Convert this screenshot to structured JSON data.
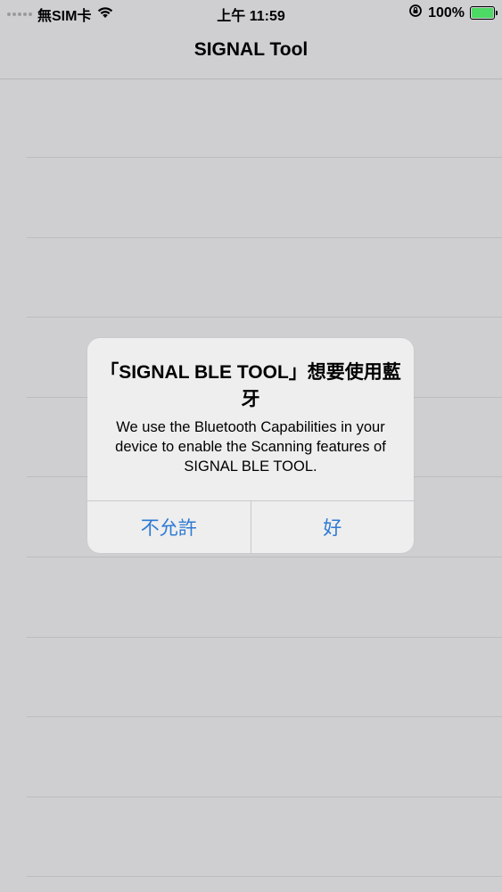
{
  "status_bar": {
    "carrier": "無SIM卡",
    "time": "上午 11:59",
    "battery_percent": "100%",
    "battery_level": 1.0,
    "icons": [
      "signal-dots-icon",
      "wifi-icon",
      "orientation-lock-icon",
      "battery-charging-icon"
    ]
  },
  "nav": {
    "title": "SIGNAL Tool"
  },
  "alert": {
    "title": "「SIGNAL BLE TOOL」想要使用藍牙",
    "message": "We use the Bluetooth Capabilities in your device to enable the Scanning features of SIGNAL BLE TOOL.",
    "deny_label": "不允許",
    "allow_label": "好"
  },
  "colors": {
    "accent": "#2f7ad3",
    "background": "#cfcfd2",
    "alert_bg": "#eeeeef",
    "battery_green": "#4cd964"
  }
}
